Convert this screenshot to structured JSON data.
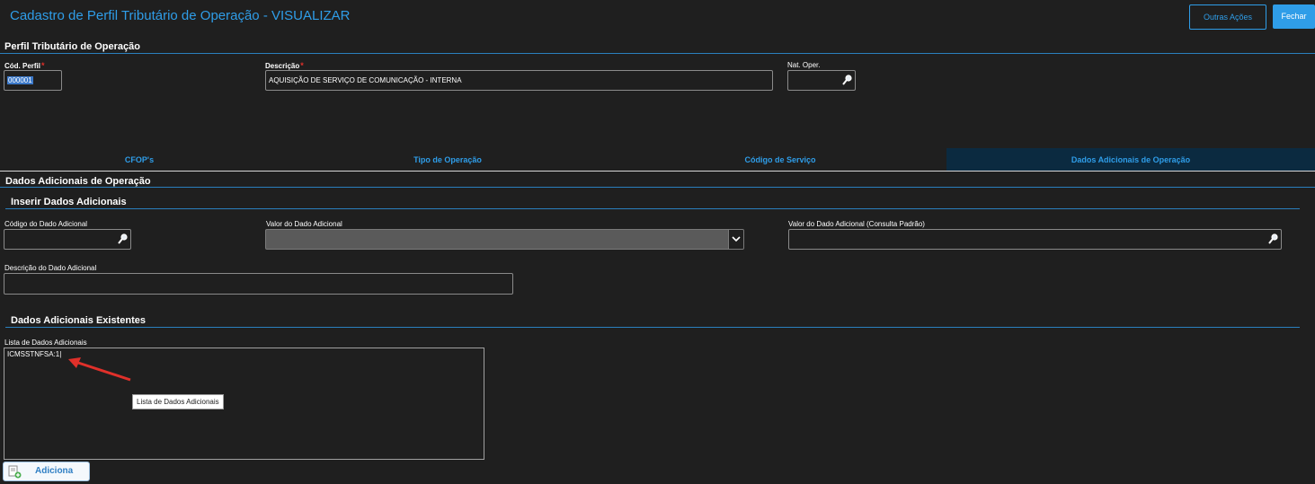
{
  "header": {
    "title": "Cadastro de Perfil Tributário de Operação - VISUALIZAR",
    "outras_acoes": "Outras Ações",
    "fechar": "Fechar"
  },
  "perfil": {
    "section_title": "Perfil Tributário de Operação",
    "cod_perfil_label": "Cód. Perfil",
    "cod_perfil_value": "000001",
    "descricao_label": "Descrição",
    "descricao_value": "AQUISIÇÃO DE SERVIÇO DE COMUNICAÇÃO - INTERNA",
    "nat_oper_label": "Nat. Oper.",
    "nat_oper_value": "",
    "required_mark": "*"
  },
  "tabs": [
    {
      "label": "CFOP's",
      "active": false
    },
    {
      "label": "Tipo de Operação",
      "active": false
    },
    {
      "label": "Código de Serviço",
      "active": false
    },
    {
      "label": "Dados Adicionais de Operação",
      "active": true
    }
  ],
  "dados": {
    "section_title": "Dados Adicionais de Operação",
    "inserir_title": "Inserir Dados Adicionais",
    "codigo_label": "Código do Dado Adicional",
    "codigo_value": "",
    "valor_label": "Valor do Dado Adicional",
    "valor_value": "",
    "valor_padrao_label": "Valor do Dado Adicional (Consulta Padrão)",
    "valor_padrao_value": "",
    "descricao_label": "Descrição do Dado Adicional",
    "descricao_value": "",
    "existentes_title": "Dados Adicionais Existentes",
    "lista_label": "Lista de Dados Adicionais",
    "lista_items": [
      "ICMSSTNFSA:1|"
    ],
    "tooltip": "Lista de Dados Adicionais",
    "adiciona": "Adiciona"
  },
  "colors": {
    "accent": "#2f9de8",
    "background": "#1f1f1f",
    "annotation_arrow": "#e0302a"
  }
}
